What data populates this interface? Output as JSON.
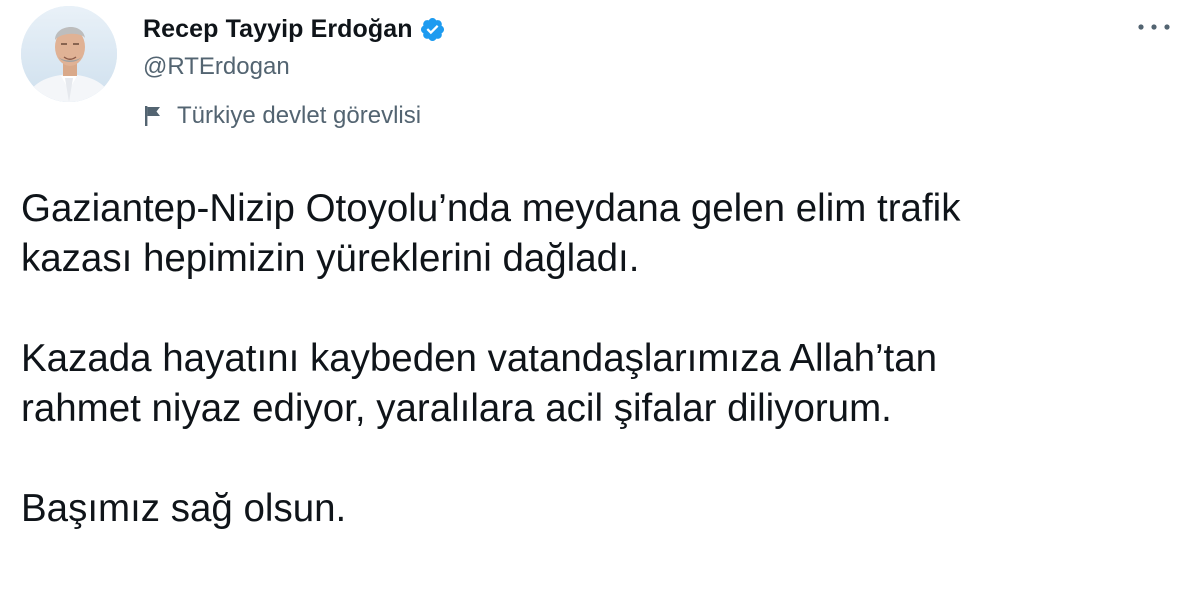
{
  "author": {
    "display_name": "Recep Tayyip Erdoğan",
    "handle": "@RTErdogan",
    "verified": true,
    "label": "Türkiye devlet görevlisi",
    "label_icon": "flag-icon",
    "avatar_icon": "avatar"
  },
  "menu": {
    "icon": "more-options-icon"
  },
  "tweet": {
    "paragraphs": [
      "Gaziantep-Nizip Otoyolu’nda meydana gelen elim trafik\nkazası hepimizin yüreklerini dağladı.",
      "Kazada hayatını kaybeden vatandaşlarımıza Allah’tan\nrahmet niyaz ediyor, yaralılara acil şifalar diliyorum.",
      "Başımız sağ olsun."
    ]
  },
  "colors": {
    "text_primary": "#0f1419",
    "text_secondary": "#536471",
    "verified_blue": "#1d9bf0",
    "background": "#ffffff"
  }
}
